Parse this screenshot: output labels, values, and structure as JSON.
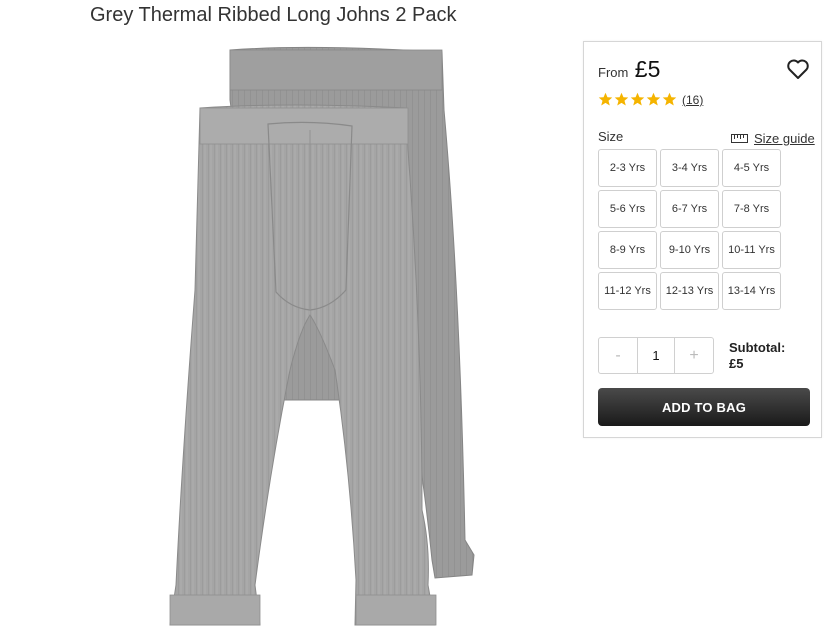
{
  "product": {
    "title": "Grey Thermal Ribbed Long Johns 2 Pack",
    "image": "grey-long-johns-image"
  },
  "price": {
    "from_label": "From",
    "value": "£5"
  },
  "rating": {
    "stars": 5,
    "max": 5,
    "review_count": "(16)",
    "star_color": "#f5b400"
  },
  "size": {
    "label": "Size",
    "guide_label": "Size guide",
    "options": [
      "2-3 Yrs",
      "3-4 Yrs",
      "4-5 Yrs",
      "5-6 Yrs",
      "6-7 Yrs",
      "7-8 Yrs",
      "8-9 Yrs",
      "9-10 Yrs",
      "10-11 Yrs",
      "11-12 Yrs",
      "12-13 Yrs",
      "13-14 Yrs"
    ]
  },
  "quantity": {
    "minus": "-",
    "value": "1",
    "plus": "+"
  },
  "subtotal": {
    "label": "Subtotal:",
    "value": "£5"
  },
  "cta": {
    "add_to_bag": "ADD TO BAG"
  },
  "icons": {
    "wishlist": "heart-icon",
    "size_guide": "ruler-icon",
    "star": "star-icon"
  }
}
